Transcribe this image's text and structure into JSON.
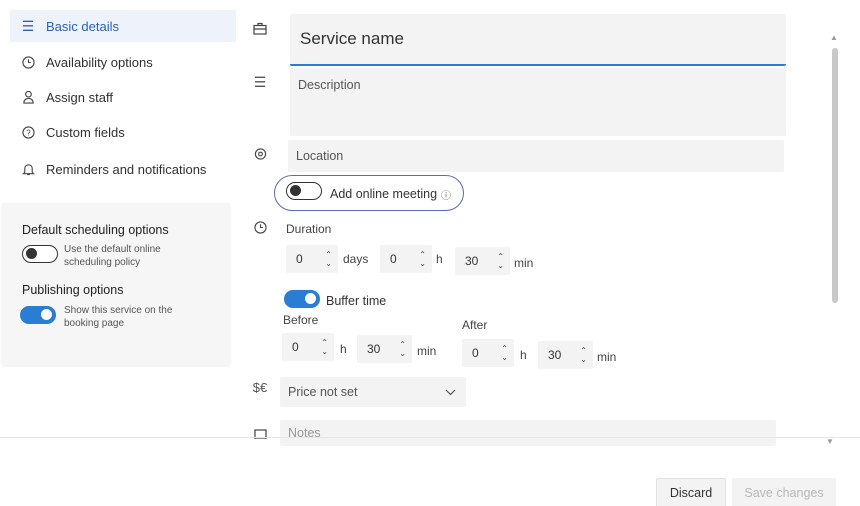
{
  "nav": {
    "items": [
      {
        "label": "Basic details",
        "icon": "list-icon",
        "active": true
      },
      {
        "label": "Availability options",
        "icon": "clock-icon"
      },
      {
        "label": "Assign staff",
        "icon": "person-icon"
      },
      {
        "label": "Custom fields",
        "icon": "question-icon"
      },
      {
        "label": "Reminders and notifications",
        "icon": "bell-icon"
      }
    ]
  },
  "options": {
    "default_scheduling_heading": "Default scheduling options",
    "default_scheduling_desc": "Use the default online scheduling policy",
    "default_scheduling_on": false,
    "publishing_heading": "Publishing options",
    "publishing_desc": "Show this service on the booking page",
    "publishing_on": true
  },
  "form": {
    "service_name_placeholder": "Service name",
    "description_placeholder": "Description",
    "location_placeholder": "Location",
    "online_meeting_label": "Add online meeting",
    "online_meeting_on": false,
    "duration_label": "Duration",
    "duration_days": "0",
    "duration_days_unit": "days",
    "duration_hours": "0",
    "duration_hours_unit": "h",
    "duration_min": "30",
    "duration_min_unit": "min",
    "buffer_label": "Buffer time",
    "buffer_on": true,
    "before_label": "Before",
    "before_hours": "0",
    "before_hours_unit": "h",
    "before_min": "30",
    "before_min_unit": "min",
    "after_label": "After",
    "after_hours": "0",
    "after_hours_unit": "h",
    "after_min": "30",
    "after_min_unit": "min",
    "price_value": "Price not set",
    "price_icon_text": "$€",
    "notes_placeholder": "Notes"
  },
  "footer": {
    "discard_label": "Discard",
    "save_label": "Save changes"
  },
  "colors": {
    "accent": "#2b7cd3",
    "nav_active_bg": "#eef3fb",
    "nav_active_text": "#2b63b8"
  }
}
